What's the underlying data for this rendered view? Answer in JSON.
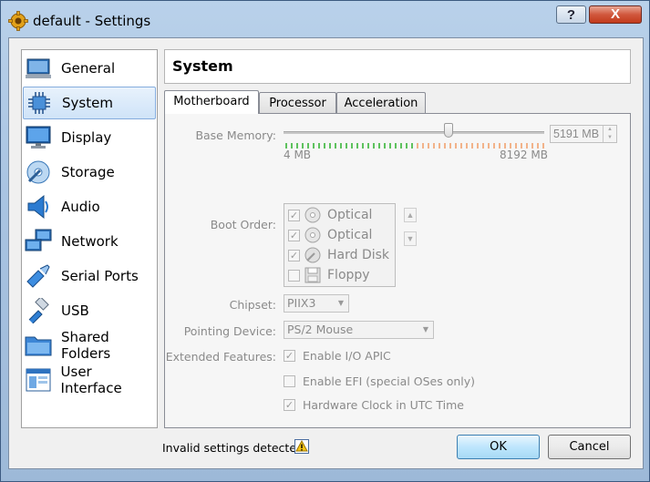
{
  "window": {
    "title": "default - Settings"
  },
  "titlebar": {
    "help_label": "?",
    "close_label": "X"
  },
  "sidebar": {
    "items": [
      {
        "label": "General",
        "icon": "general-icon"
      },
      {
        "label": "System",
        "icon": "system-icon",
        "selected": true
      },
      {
        "label": "Display",
        "icon": "display-icon"
      },
      {
        "label": "Storage",
        "icon": "storage-icon"
      },
      {
        "label": "Audio",
        "icon": "audio-icon"
      },
      {
        "label": "Network",
        "icon": "network-icon"
      },
      {
        "label": "Serial Ports",
        "icon": "serial-ports-icon"
      },
      {
        "label": "USB",
        "icon": "usb-icon"
      },
      {
        "label": "Shared Folders",
        "icon": "shared-folders-icon"
      },
      {
        "label": "User Interface",
        "icon": "user-interface-icon"
      }
    ]
  },
  "page": {
    "title": "System"
  },
  "tabs": [
    {
      "label": "Motherboard",
      "active": true
    },
    {
      "label": "Processor"
    },
    {
      "label": "Acceleration"
    }
  ],
  "motherboard": {
    "base_memory": {
      "label": "Base Memory:",
      "min_label": "4 MB",
      "max_label": "8192 MB",
      "value": "5191 MB",
      "fraction": 0.633
    },
    "boot_order": {
      "label": "Boot Order:",
      "items": [
        {
          "label": "Optical",
          "checked": true,
          "icon": "optical-disc-icon"
        },
        {
          "label": "Optical",
          "checked": true,
          "icon": "optical-disc-icon"
        },
        {
          "label": "Hard Disk",
          "checked": true,
          "icon": "hard-disk-icon"
        },
        {
          "label": "Floppy",
          "checked": false,
          "icon": "floppy-icon"
        }
      ]
    },
    "chipset": {
      "label": "Chipset:",
      "value": "PIIX3"
    },
    "pointing_device": {
      "label": "Pointing Device:",
      "value": "PS/2 Mouse"
    },
    "extended_features": {
      "label": "Extended Features:",
      "items": [
        {
          "label": "Enable I/O APIC",
          "checked": true
        },
        {
          "label": "Enable EFI (special OSes only)",
          "checked": false
        },
        {
          "label": "Hardware Clock in UTC Time",
          "checked": true
        }
      ]
    }
  },
  "status": {
    "message": "Invalid settings detected"
  },
  "buttons": {
    "ok": "OK",
    "cancel": "Cancel"
  },
  "colors": {
    "slider_green": "#5ec25e",
    "slider_orange": "#f2b38a",
    "selection": "#cfe3f8"
  }
}
